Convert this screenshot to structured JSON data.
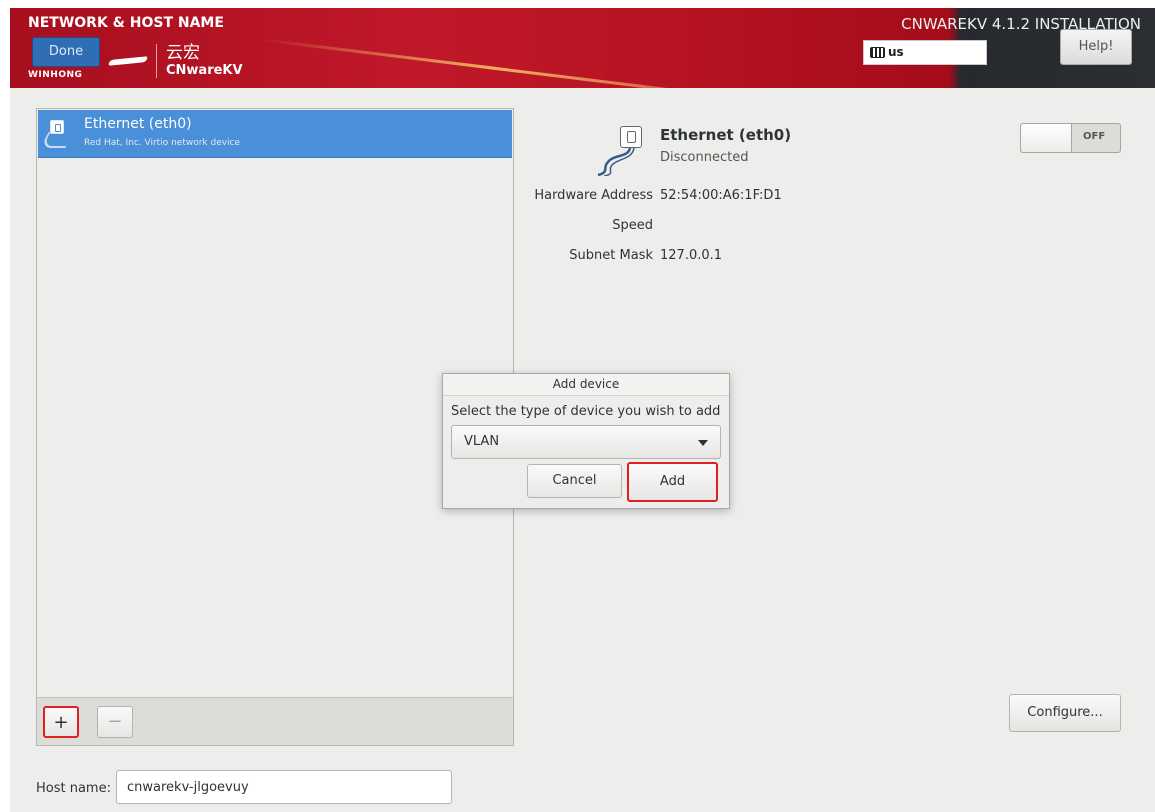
{
  "header": {
    "spoke_title": "NETWORK & HOST NAME",
    "done_label": "Done",
    "logo_cn": "云宏",
    "logo_en": "CNwareKV",
    "logo_sub": "WINHONG",
    "install_title": "CNWAREKV 4.1.2 INSTALLATION",
    "keyboard_layout": "us",
    "help_label": "Help!"
  },
  "devices": {
    "items": [
      {
        "name": "Ethernet (eth0)",
        "description": "Red Hat, Inc. Virtio network device"
      }
    ],
    "add_label": "+",
    "remove_label": "−"
  },
  "details": {
    "name": "Ethernet (eth0)",
    "status": "Disconnected",
    "toggle_label": "OFF",
    "rows": [
      {
        "key": "Hardware Address",
        "value": "52:54:00:A6:1F:D1"
      },
      {
        "key": "Speed",
        "value": ""
      },
      {
        "key": "Subnet Mask",
        "value": "127.0.0.1"
      }
    ],
    "configure_label": "Configure..."
  },
  "hostname": {
    "label": "Host name:",
    "value": "cnwarekv-jlgoevuy"
  },
  "dialog": {
    "title": "Add device",
    "prompt": "Select the type of device you wish to add",
    "selected": "VLAN",
    "cancel_label": "Cancel",
    "add_label": "Add"
  }
}
